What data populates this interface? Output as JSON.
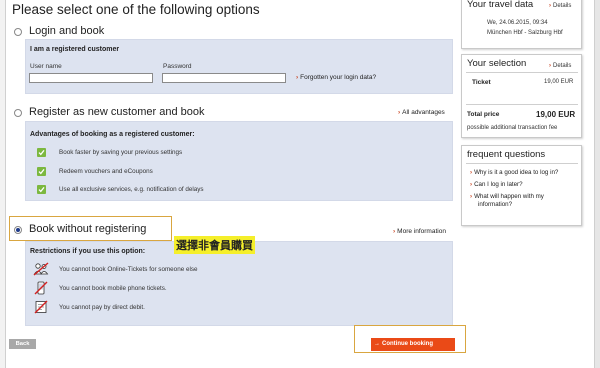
{
  "page": {
    "title": "Please select one of the following options"
  },
  "login_option": {
    "label": "Login and book",
    "panel_title": "I am a registered customer",
    "username_label": "User name",
    "username_value": "",
    "password_label": "Password",
    "password_value": "",
    "forgotten_link": "Forgotten your login data?"
  },
  "register_option": {
    "label": "Register as new customer and book",
    "all_advantages_link": "All advantages",
    "panel_title": "Advantages of booking as a registered customer:",
    "advantages": [
      "Book faster by saving your previous settings",
      "Redeem vouchers and eCoupons",
      "Use all exclusive services, e.g. notification of delays"
    ]
  },
  "guest_option": {
    "label": "Book without registering",
    "more_info_link": "More information",
    "annotation": "選擇非會員購買",
    "panel_title": "Restrictions if you use this option:",
    "restrictions": [
      "You cannot book Online-Tickets for someone else",
      "You cannot book mobile phone tickets.",
      "You cannot pay by direct debit."
    ]
  },
  "buttons": {
    "back": "Back",
    "continue": "Continue booking"
  },
  "travel_data": {
    "title": "Your travel data",
    "details_link": "Details",
    "datetime": "We, 24.06.2015, 09:34",
    "route": "München Hbf - Salzburg Hbf"
  },
  "selection": {
    "title": "Your selection",
    "details_link": "Details",
    "ticket_label": "Ticket",
    "ticket_price": "19,00 EUR",
    "total_label": "Total price",
    "total_price": "19,00 EUR",
    "fee_note": "possible additional transaction fee"
  },
  "faq": {
    "title": "frequent questions",
    "items": [
      "Why is it a good idea to log in?",
      "Can I log in later?",
      "What will happen with my information?"
    ]
  },
  "colors": {
    "accent_orange": "#ea4a17",
    "panel_blue": "#dde3f0",
    "highlight_border": "#d9a640",
    "annotation_yellow": "#f5ef2a",
    "check_green": "#7cb83f"
  }
}
